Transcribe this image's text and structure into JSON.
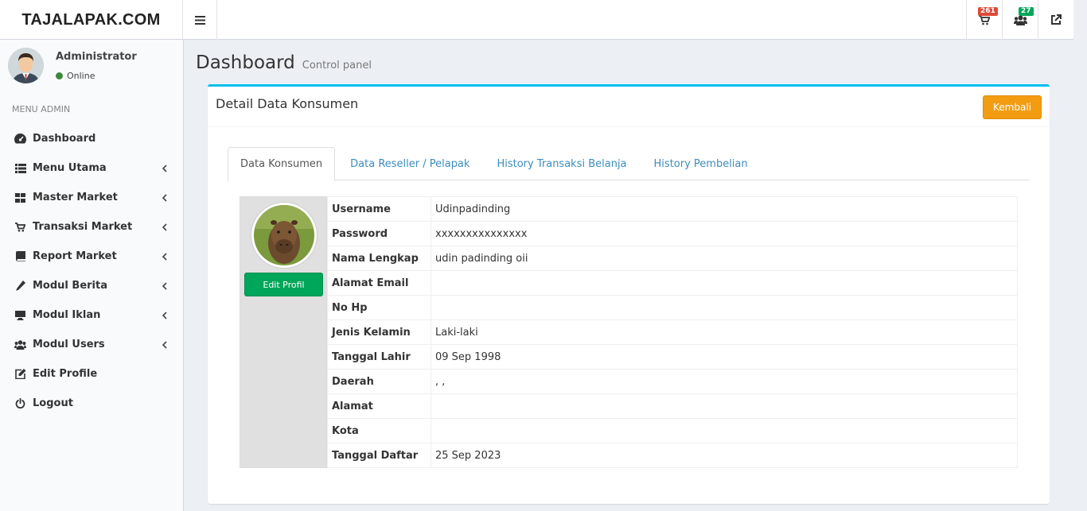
{
  "brand": "TAJALAPAK.COM",
  "header": {
    "cart_badge": "261",
    "users_badge": "27"
  },
  "user": {
    "name": "Administrator",
    "status": "Online"
  },
  "sidebar": {
    "header": "MENU ADMIN",
    "items": [
      {
        "label": "Dashboard",
        "icon": "dashboard-icon"
      },
      {
        "label": "Menu Utama",
        "icon": "list-icon"
      },
      {
        "label": "Master Market",
        "icon": "grid-icon"
      },
      {
        "label": "Transaksi Market",
        "icon": "cart-icon"
      },
      {
        "label": "Report Market",
        "icon": "book-icon"
      },
      {
        "label": "Modul Berita",
        "icon": "pencil-icon"
      },
      {
        "label": "Modul Iklan",
        "icon": "monitor-icon"
      },
      {
        "label": "Modul Users",
        "icon": "users-icon"
      },
      {
        "label": "Edit Profile",
        "icon": "edit-icon"
      },
      {
        "label": "Logout",
        "icon": "power-icon"
      }
    ]
  },
  "page": {
    "title": "Dashboard",
    "subtitle": "Control panel"
  },
  "box": {
    "title": "Detail Data Konsumen",
    "back_label": "Kembali",
    "edit_label": "Edit Profil"
  },
  "tabs": [
    "Data Konsumen",
    "Data Reseller / Pelapak",
    "History Transaksi Belanja",
    "History Pembelian"
  ],
  "details": [
    {
      "key": "Username",
      "value": "Udinpadinding"
    },
    {
      "key": "Password",
      "value": "xxxxxxxxxxxxxxx"
    },
    {
      "key": "Nama Lengkap",
      "value": "udin padinding oii"
    },
    {
      "key": "Alamat Email",
      "value": ""
    },
    {
      "key": "No Hp",
      "value": ""
    },
    {
      "key": "Jenis Kelamin",
      "value": "Laki-laki"
    },
    {
      "key": "Tanggal Lahir",
      "value": "09 Sep 1998"
    },
    {
      "key": "Daerah",
      "value": ", ,"
    },
    {
      "key": "Alamat",
      "value": ""
    },
    {
      "key": "Kota",
      "value": ""
    },
    {
      "key": "Tanggal Daftar",
      "value": "25 Sep 2023"
    }
  ],
  "colors": {
    "accent": "#00c0ef",
    "back_button": "#f39c12",
    "edit_button": "#00a65a",
    "badge_red": "#dd4b39",
    "badge_green": "#00a65a"
  }
}
